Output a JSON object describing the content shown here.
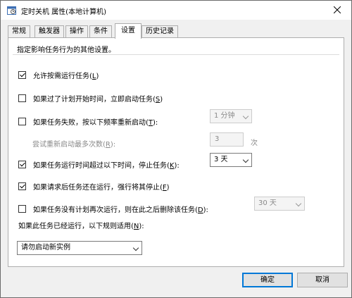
{
  "window": {
    "title": "定时关机 属性(本地计算机)",
    "accent": "#0078d7"
  },
  "tabs": [
    {
      "label": "常规"
    },
    {
      "label": "触发器"
    },
    {
      "label": "操作"
    },
    {
      "label": "条件"
    },
    {
      "label": "设置",
      "active": true
    },
    {
      "label": "历史记录"
    }
  ],
  "settings": {
    "description": "指定影响任务行为的其他设置。",
    "allow_on_demand": {
      "label": "允许按需运行任务(",
      "hotkey": "L",
      "suffix": ")",
      "checked": true
    },
    "run_asap": {
      "label": "如果过了计划开始时间，立即启动任务(",
      "hotkey": "S",
      "suffix": ")",
      "checked": false
    },
    "restart_on_fail": {
      "label": "如果任务失败，按以下频率重新启动(",
      "hotkey": "T",
      "suffix": "):",
      "checked": false,
      "interval_value": "1 分钟"
    },
    "restart_attempts": {
      "label": "尝试重新启动最多次数(",
      "hotkey": "R",
      "suffix": "):",
      "value": "3",
      "unit": "次"
    },
    "stop_if_runs_longer": {
      "label": "如果任务运行时间超过以下时间，停止任务(",
      "hotkey": "K",
      "suffix": "):",
      "checked": true,
      "duration_value": "3 天"
    },
    "force_stop": {
      "label": "如果请求后任务还在运行，强行将其停止(",
      "hotkey": "F",
      "suffix": ")",
      "checked": true
    },
    "delete_if_not_scheduled": {
      "label": "如果任务没有计划再次运行，则在此之后删除该任务(",
      "hotkey": "D",
      "suffix": "):",
      "checked": false,
      "after_value": "30 天"
    },
    "running_rule": {
      "label": "如果此任务已经运行，以下规则适用(",
      "hotkey": "N",
      "suffix": "):",
      "value": "请勿启动新实例"
    }
  },
  "buttons": {
    "ok": "确定",
    "cancel": "取消"
  }
}
